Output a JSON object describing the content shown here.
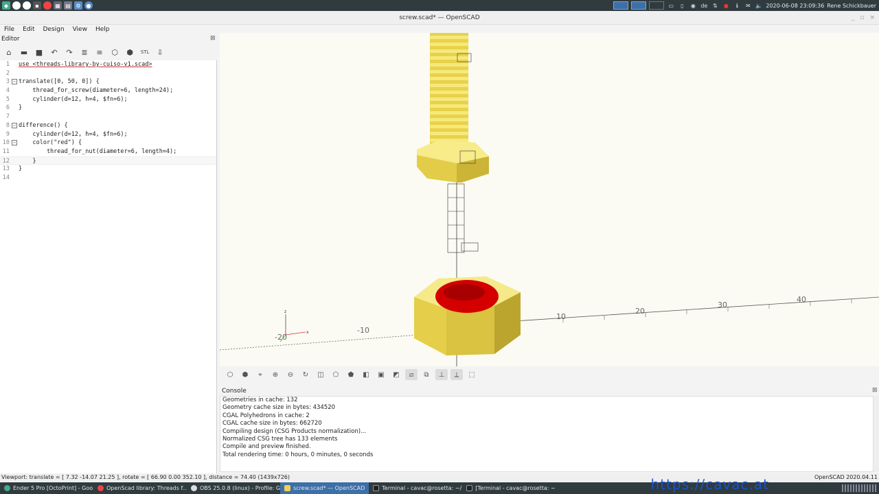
{
  "system_panel": {
    "clock": "2020-06-08 23:09:36",
    "user": "Rene Schickbauer",
    "keyboard_layout": "de",
    "launchers": [
      "start-icon",
      "chrome-icon",
      "files-icon",
      "terminal-icon",
      "settings-icon",
      "app-icon"
    ]
  },
  "window": {
    "title": "screw.scad* — OpenSCAD"
  },
  "menubar": {
    "items": [
      "File",
      "Edit",
      "Design",
      "View",
      "Help"
    ]
  },
  "editor": {
    "title": "Editor",
    "toolbar": [
      "new-icon",
      "open-icon",
      "save-icon",
      "undo-icon",
      "redo-icon",
      "unindent-icon",
      "indent-icon",
      "preview-icon",
      "render-icon",
      "export-stl-icon",
      "send-to-print-icon"
    ],
    "lines": [
      {
        "n": "1",
        "fold": "",
        "text": "use <threads-library-by-cuiso-v1.scad>"
      },
      {
        "n": "2",
        "fold": "",
        "text": ""
      },
      {
        "n": "3",
        "fold": "⊟",
        "text": "translate([0, 50, 0]) {"
      },
      {
        "n": "4",
        "fold": "",
        "text": "    thread_for_screw(diameter=6, length=24);"
      },
      {
        "n": "5",
        "fold": "",
        "text": "    cylinder(d=12, h=4, $fn=6);"
      },
      {
        "n": "6",
        "fold": "",
        "text": "}"
      },
      {
        "n": "7",
        "fold": "",
        "text": ""
      },
      {
        "n": "8",
        "fold": "⊟",
        "text": "difference() {"
      },
      {
        "n": "9",
        "fold": "",
        "text": "    cylinder(d=12, h=4, $fn=6);"
      },
      {
        "n": "10",
        "fold": "⊟",
        "text": "    color(\"red\") {"
      },
      {
        "n": "11",
        "fold": "",
        "text": "        thread_for_nut(diameter=6, length=4);"
      },
      {
        "n": "12",
        "fold": "",
        "text": "    }"
      },
      {
        "n": "13",
        "fold": "",
        "text": "}"
      },
      {
        "n": "14",
        "fold": "",
        "text": ""
      }
    ]
  },
  "viewport": {
    "axis_labels": [
      "-20",
      "-10",
      "10",
      "20",
      "30",
      "40"
    ],
    "colors": {
      "screw": "#f2e05a",
      "nut_hole": "#d40000"
    }
  },
  "view_toolbar": [
    "preview-icon",
    "render-icon",
    "view-all-icon",
    "zoom-in-icon",
    "zoom-out-icon",
    "reset-view-icon",
    "view-right-icon",
    "view-top-icon",
    "view-bottom-icon",
    "view-left-icon",
    "view-front-icon",
    "view-back-icon",
    "perspective-icon",
    "orthogonal-icon",
    "show-axes-icon",
    "show-scale-icon",
    "show-edges-icon"
  ],
  "console": {
    "title": "Console",
    "lines": [
      "Geometries in cache: 132",
      "Geometry cache size in bytes: 434520",
      "CGAL Polyhedrons in cache: 2",
      "CGAL cache size in bytes: 662720",
      "Compiling design (CSG Products normalization)...",
      "Normalized CSG tree has 133 elements",
      "Compile and preview finished.",
      "Total rendering time: 0 hours, 0 minutes, 0 seconds"
    ]
  },
  "statusbar": {
    "left": "Viewport: translate = [ 7.32 -14.07 21.25 ], rotate = [ 66.90 0.00 352.10 ], distance = 74.40 (1439x726)",
    "right": "OpenSCAD 2020.04.11"
  },
  "taskbar": {
    "tasks": [
      {
        "label": "Ender 5 Pro [OctoPrint] - Goo...",
        "active": false
      },
      {
        "label": "OpenScad library: Threads f...",
        "active": false
      },
      {
        "label": "OBS 25.0.8 (linux) - Profile: G...",
        "active": false
      },
      {
        "label": "screw.scad* — OpenSCAD",
        "active": true
      },
      {
        "label": "Terminal - cavac@rosetta: ~/...",
        "active": false
      },
      {
        "label": "[Terminal - cavac@rosetta: ~]",
        "active": false
      }
    ],
    "watermark": "https://cavac.at"
  }
}
